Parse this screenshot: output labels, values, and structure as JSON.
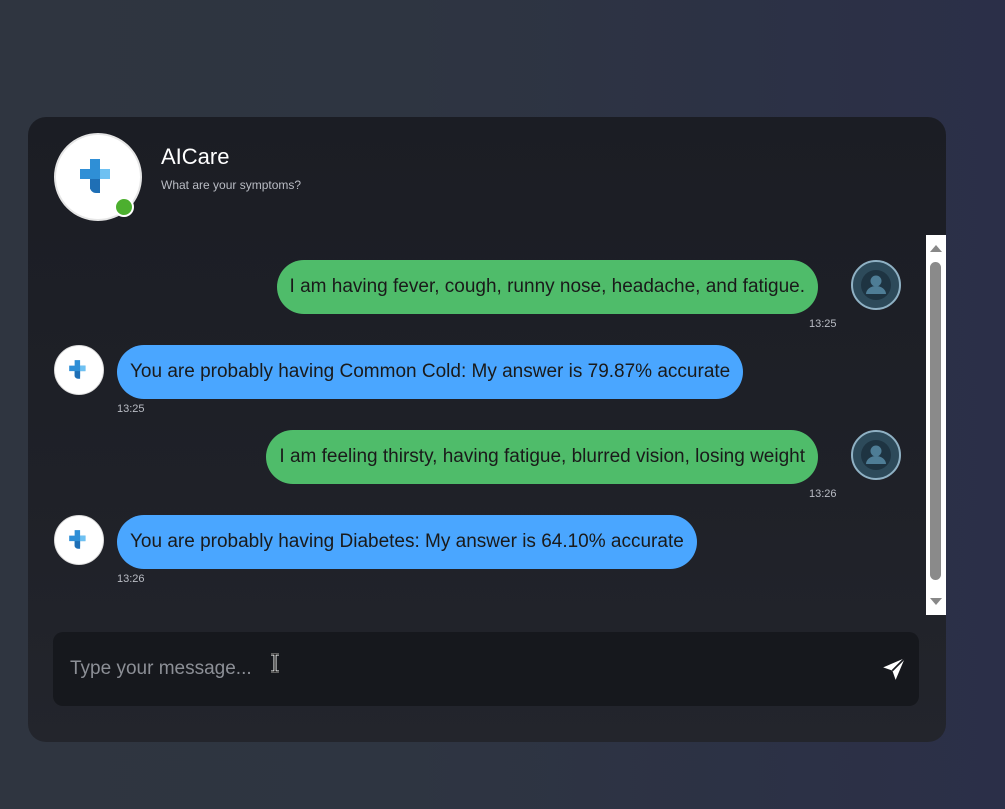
{
  "header": {
    "title": "AICare",
    "subtitle": "What are your symptoms?",
    "status": "online"
  },
  "messages": [
    {
      "sender": "user",
      "text": "I am having fever, cough, runny nose, headache, and fatigue.",
      "time": "13:25"
    },
    {
      "sender": "bot",
      "text": "You are probably having Common Cold: My answer is 79.87% accurate",
      "time": "13:25"
    },
    {
      "sender": "user",
      "text": "I am feeling thirsty, having fatigue, blurred vision, losing weight",
      "time": "13:26"
    },
    {
      "sender": "bot",
      "text": "You are probably having Diabetes: My answer is 64.10% accurate",
      "time": "13:26"
    }
  ],
  "composer": {
    "placeholder": "Type your message...",
    "value": ""
  },
  "icons": {
    "logo": "medical-cross-icon",
    "user_avatar": "user-icon",
    "send": "send-icon"
  },
  "colors": {
    "user_bubble": "#4fbc6a",
    "bot_bubble": "#4aa6ff",
    "online": "#4caf2f"
  }
}
